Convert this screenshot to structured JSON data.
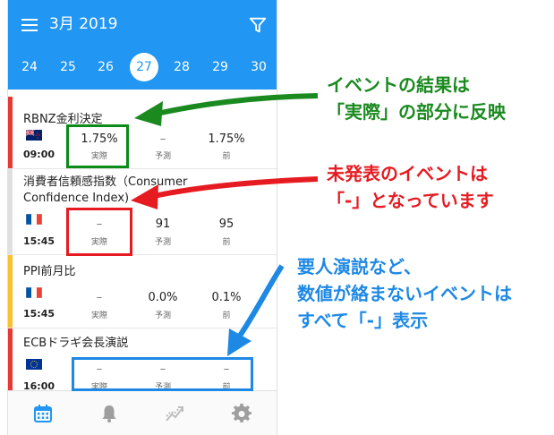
{
  "header": {
    "month": "3月 2019",
    "menu_icon": "menu-icon",
    "filter_icon": "filter-icon",
    "color": "#2196f3"
  },
  "days": [
    "24",
    "25",
    "26",
    "27",
    "28",
    "29",
    "30"
  ],
  "selected_day": "27",
  "labels": {
    "actual": "実際",
    "forecast": "予測",
    "previous": "前"
  },
  "events": [
    {
      "name": "RBNZ金利決定",
      "flag": "new-zealand-flag",
      "time": "09:00",
      "actual": "1.75%",
      "forecast": "–",
      "previous": "1.75%",
      "importance_color": "#e53935"
    },
    {
      "name_line1": "消費者信頼感指数（Consumer",
      "name_line2": "Confidence Index)",
      "flag": "france-flag",
      "time": "15:45",
      "actual": "–",
      "forecast": "91",
      "previous": "95",
      "importance_color": "#e0e0e0"
    },
    {
      "name": "PPI前月比",
      "flag": "france-flag",
      "time": "15:45",
      "actual": "–",
      "forecast": "0.0%",
      "previous": "0.1%",
      "importance_color": "#fbc02d"
    },
    {
      "name": "ECBドラギ会長演説",
      "flag": "eu-flag",
      "time": "16:00",
      "actual": "–",
      "forecast": "–",
      "previous": "–",
      "importance_color": "#e53935"
    }
  ],
  "bottom_nav": [
    "calendar-icon",
    "bell-icon",
    "chart-icon",
    "gear-icon"
  ],
  "annotations": {
    "green": {
      "line1": "イベントの結果は",
      "line2": "「実際」の部分に反映",
      "color": "#1a8a1f"
    },
    "red": {
      "line1": "未発表のイベントは",
      "line2": "「-」となっています",
      "color": "#e61b22"
    },
    "blue": {
      "line1": "要人演説など、",
      "line2": "数値が絡まないイベントは",
      "line3": "すべて「-」表示",
      "color": "#1e88e5"
    }
  }
}
